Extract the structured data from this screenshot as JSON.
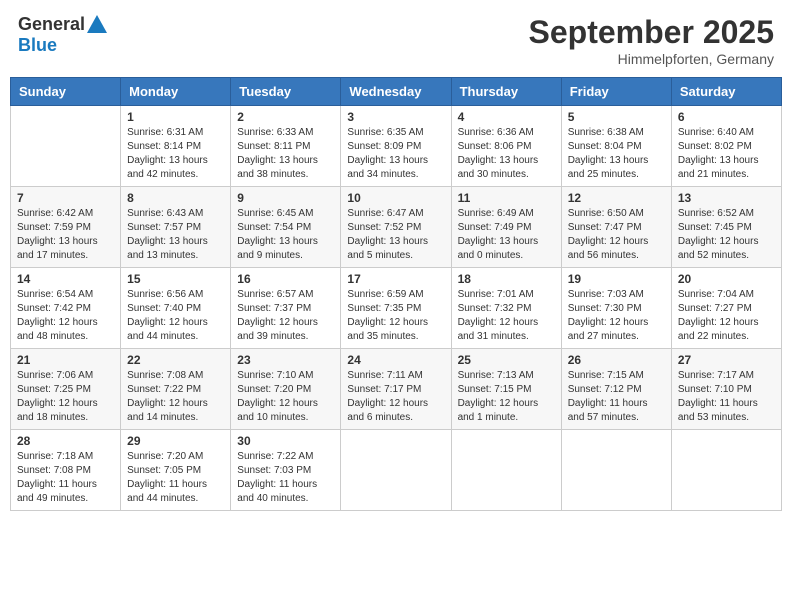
{
  "header": {
    "logo_general": "General",
    "logo_blue": "Blue",
    "month_title": "September 2025",
    "subtitle": "Himmelpforten, Germany"
  },
  "days_of_week": [
    "Sunday",
    "Monday",
    "Tuesday",
    "Wednesday",
    "Thursday",
    "Friday",
    "Saturday"
  ],
  "weeks": [
    [
      {
        "day": "",
        "info": ""
      },
      {
        "day": "1",
        "info": "Sunrise: 6:31 AM\nSunset: 8:14 PM\nDaylight: 13 hours\nand 42 minutes."
      },
      {
        "day": "2",
        "info": "Sunrise: 6:33 AM\nSunset: 8:11 PM\nDaylight: 13 hours\nand 38 minutes."
      },
      {
        "day": "3",
        "info": "Sunrise: 6:35 AM\nSunset: 8:09 PM\nDaylight: 13 hours\nand 34 minutes."
      },
      {
        "day": "4",
        "info": "Sunrise: 6:36 AM\nSunset: 8:06 PM\nDaylight: 13 hours\nand 30 minutes."
      },
      {
        "day": "5",
        "info": "Sunrise: 6:38 AM\nSunset: 8:04 PM\nDaylight: 13 hours\nand 25 minutes."
      },
      {
        "day": "6",
        "info": "Sunrise: 6:40 AM\nSunset: 8:02 PM\nDaylight: 13 hours\nand 21 minutes."
      }
    ],
    [
      {
        "day": "7",
        "info": "Sunrise: 6:42 AM\nSunset: 7:59 PM\nDaylight: 13 hours\nand 17 minutes."
      },
      {
        "day": "8",
        "info": "Sunrise: 6:43 AM\nSunset: 7:57 PM\nDaylight: 13 hours\nand 13 minutes."
      },
      {
        "day": "9",
        "info": "Sunrise: 6:45 AM\nSunset: 7:54 PM\nDaylight: 13 hours\nand 9 minutes."
      },
      {
        "day": "10",
        "info": "Sunrise: 6:47 AM\nSunset: 7:52 PM\nDaylight: 13 hours\nand 5 minutes."
      },
      {
        "day": "11",
        "info": "Sunrise: 6:49 AM\nSunset: 7:49 PM\nDaylight: 13 hours\nand 0 minutes."
      },
      {
        "day": "12",
        "info": "Sunrise: 6:50 AM\nSunset: 7:47 PM\nDaylight: 12 hours\nand 56 minutes."
      },
      {
        "day": "13",
        "info": "Sunrise: 6:52 AM\nSunset: 7:45 PM\nDaylight: 12 hours\nand 52 minutes."
      }
    ],
    [
      {
        "day": "14",
        "info": "Sunrise: 6:54 AM\nSunset: 7:42 PM\nDaylight: 12 hours\nand 48 minutes."
      },
      {
        "day": "15",
        "info": "Sunrise: 6:56 AM\nSunset: 7:40 PM\nDaylight: 12 hours\nand 44 minutes."
      },
      {
        "day": "16",
        "info": "Sunrise: 6:57 AM\nSunset: 7:37 PM\nDaylight: 12 hours\nand 39 minutes."
      },
      {
        "day": "17",
        "info": "Sunrise: 6:59 AM\nSunset: 7:35 PM\nDaylight: 12 hours\nand 35 minutes."
      },
      {
        "day": "18",
        "info": "Sunrise: 7:01 AM\nSunset: 7:32 PM\nDaylight: 12 hours\nand 31 minutes."
      },
      {
        "day": "19",
        "info": "Sunrise: 7:03 AM\nSunset: 7:30 PM\nDaylight: 12 hours\nand 27 minutes."
      },
      {
        "day": "20",
        "info": "Sunrise: 7:04 AM\nSunset: 7:27 PM\nDaylight: 12 hours\nand 22 minutes."
      }
    ],
    [
      {
        "day": "21",
        "info": "Sunrise: 7:06 AM\nSunset: 7:25 PM\nDaylight: 12 hours\nand 18 minutes."
      },
      {
        "day": "22",
        "info": "Sunrise: 7:08 AM\nSunset: 7:22 PM\nDaylight: 12 hours\nand 14 minutes."
      },
      {
        "day": "23",
        "info": "Sunrise: 7:10 AM\nSunset: 7:20 PM\nDaylight: 12 hours\nand 10 minutes."
      },
      {
        "day": "24",
        "info": "Sunrise: 7:11 AM\nSunset: 7:17 PM\nDaylight: 12 hours\nand 6 minutes."
      },
      {
        "day": "25",
        "info": "Sunrise: 7:13 AM\nSunset: 7:15 PM\nDaylight: 12 hours\nand 1 minute."
      },
      {
        "day": "26",
        "info": "Sunrise: 7:15 AM\nSunset: 7:12 PM\nDaylight: 11 hours\nand 57 minutes."
      },
      {
        "day": "27",
        "info": "Sunrise: 7:17 AM\nSunset: 7:10 PM\nDaylight: 11 hours\nand 53 minutes."
      }
    ],
    [
      {
        "day": "28",
        "info": "Sunrise: 7:18 AM\nSunset: 7:08 PM\nDaylight: 11 hours\nand 49 minutes."
      },
      {
        "day": "29",
        "info": "Sunrise: 7:20 AM\nSunset: 7:05 PM\nDaylight: 11 hours\nand 44 minutes."
      },
      {
        "day": "30",
        "info": "Sunrise: 7:22 AM\nSunset: 7:03 PM\nDaylight: 11 hours\nand 40 minutes."
      },
      {
        "day": "",
        "info": ""
      },
      {
        "day": "",
        "info": ""
      },
      {
        "day": "",
        "info": ""
      },
      {
        "day": "",
        "info": ""
      }
    ]
  ]
}
